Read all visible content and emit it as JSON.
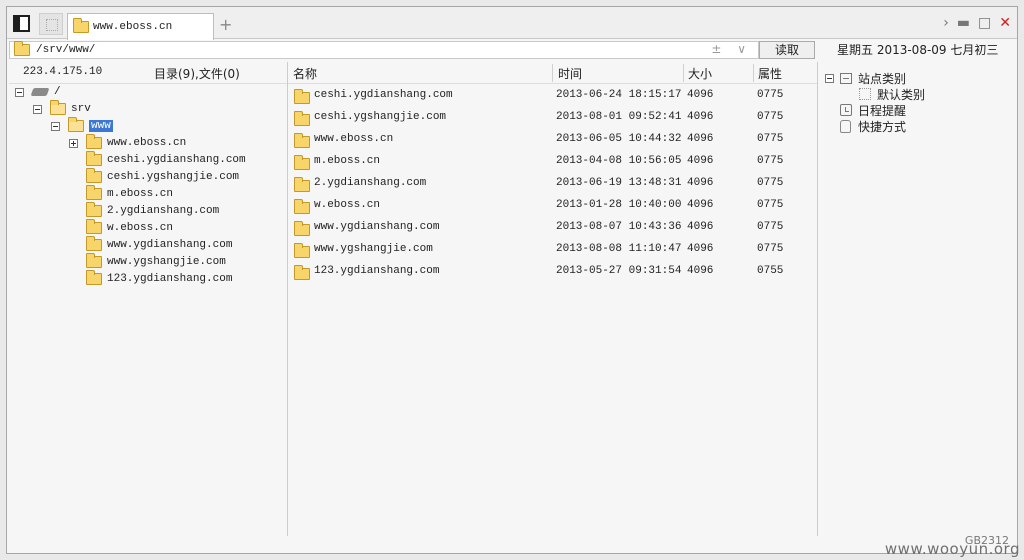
{
  "tab": {
    "title": "www.eboss.cn",
    "new_tab": "+"
  },
  "window_controls": {
    "forward": "›",
    "minimize": "▬",
    "maximize": "□",
    "close": "✕"
  },
  "pathbar": {
    "path": "/srv/www/",
    "actions": "± ∨"
  },
  "read_button": "读取",
  "date_label": "星期五 2013-08-09 七月初三",
  "left": {
    "ip": "223.4.175.10",
    "dir_count": "目录(9),文件(0)",
    "tree": {
      "root": "/",
      "srv": "srv",
      "www": "www",
      "children": [
        "www.eboss.cn",
        "ceshi.ygdianshang.com",
        "ceshi.ygshangjie.com",
        "m.eboss.cn",
        "2.ygdianshang.com",
        "w.eboss.cn",
        "www.ygdianshang.com",
        "www.ygshangjie.com",
        "123.ygdianshang.com"
      ]
    }
  },
  "table": {
    "columns": [
      "名称",
      "时间",
      "大小",
      "属性"
    ],
    "rows": [
      {
        "name": "ceshi.ygdianshang.com",
        "time": "2013-06-24 18:15:17",
        "size": "4096",
        "attr": "0775"
      },
      {
        "name": "ceshi.ygshangjie.com",
        "time": "2013-08-01 09:52:41",
        "size": "4096",
        "attr": "0775"
      },
      {
        "name": "www.eboss.cn",
        "time": "2013-06-05 10:44:32",
        "size": "4096",
        "attr": "0775"
      },
      {
        "name": "m.eboss.cn",
        "time": "2013-04-08 10:56:05",
        "size": "4096",
        "attr": "0775"
      },
      {
        "name": "2.ygdianshang.com",
        "time": "2013-06-19 13:48:31",
        "size": "4096",
        "attr": "0775"
      },
      {
        "name": "w.eboss.cn",
        "time": "2013-01-28 10:40:00",
        "size": "4096",
        "attr": "0775"
      },
      {
        "name": "www.ygdianshang.com",
        "time": "2013-08-07 10:43:36",
        "size": "4096",
        "attr": "0775"
      },
      {
        "name": "www.ygshangjie.com",
        "time": "2013-08-08 11:10:47",
        "size": "4096",
        "attr": "0775"
      },
      {
        "name": "123.ygdianshang.com",
        "time": "2013-05-27 09:31:54",
        "size": "4096",
        "attr": "0755"
      }
    ]
  },
  "right": {
    "site_category": "站点类别",
    "default_category": "默认类别",
    "schedule": "日程提醒",
    "shortcut": "快捷方式"
  },
  "status": {
    "encoding": "GB2312"
  },
  "watermark": "www.wooyun.org"
}
